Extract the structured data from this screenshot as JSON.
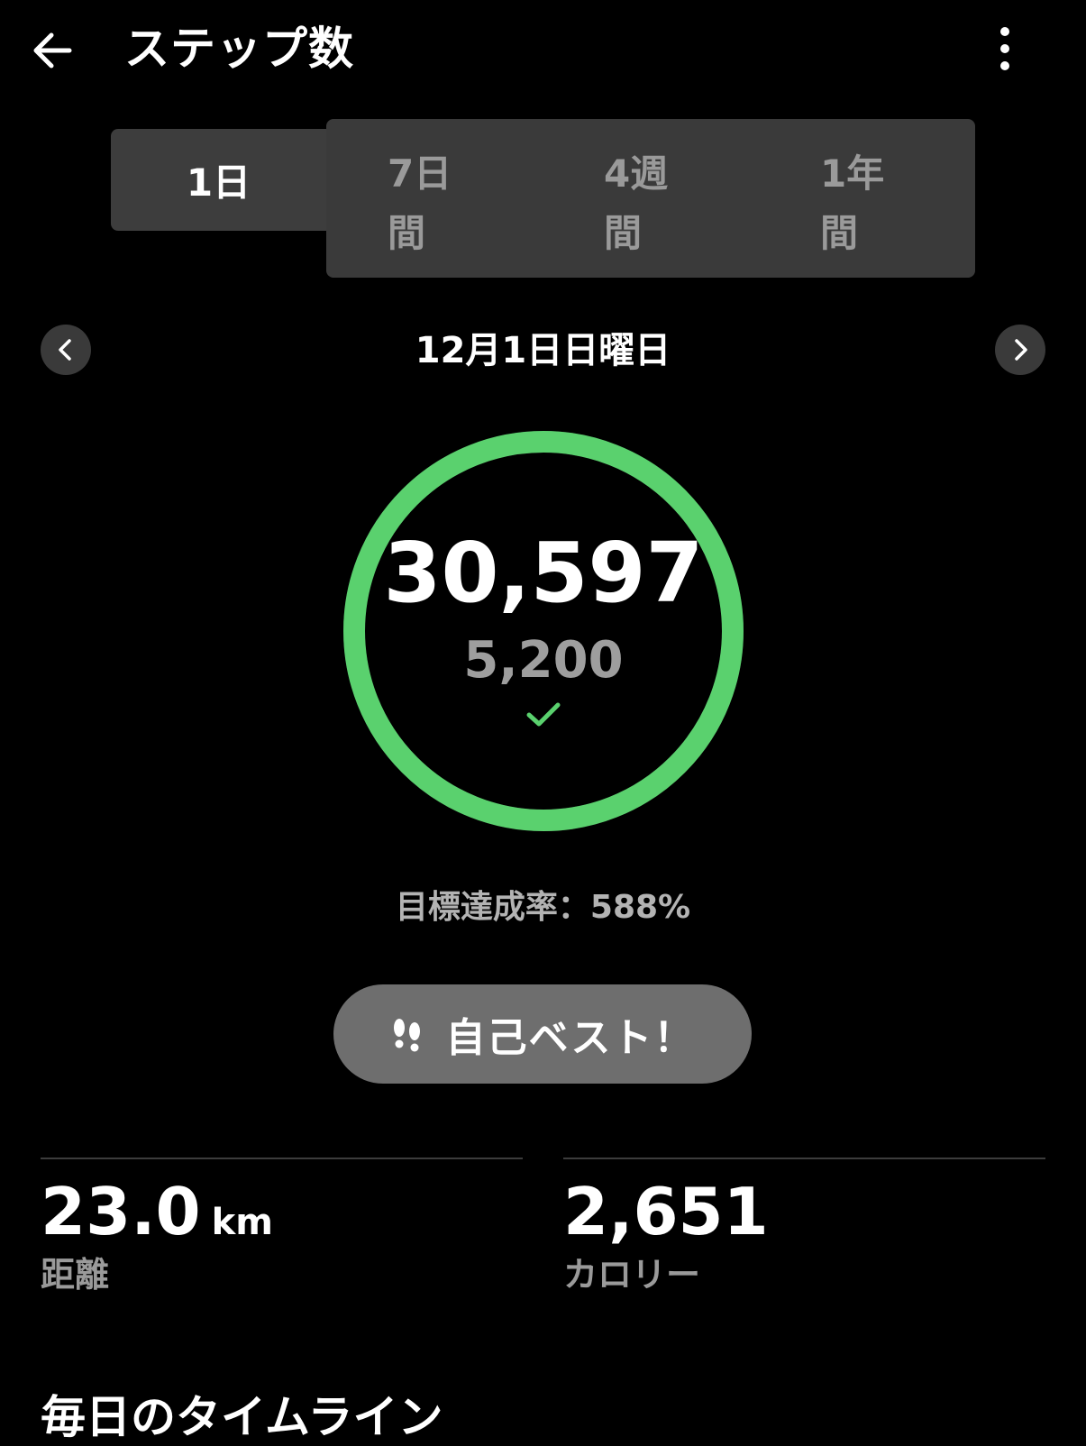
{
  "header": {
    "title": "ステップ数",
    "back_icon": "arrow-left-icon",
    "more_icon": "more-vertical-icon"
  },
  "tabs": [
    {
      "label": "1日",
      "selected": true
    },
    {
      "line1": "7日",
      "line2": "間",
      "selected": false
    },
    {
      "line1": "4週",
      "line2": "間",
      "selected": false
    },
    {
      "line1": "1年",
      "line2": "間",
      "selected": false
    }
  ],
  "date_nav": {
    "date": "12月1日日曜日",
    "prev_icon": "chevron-left-icon",
    "next_icon": "chevron-right-icon"
  },
  "summary": {
    "steps": "30,597",
    "goal": "5,200",
    "goal_progress": 1.0,
    "ring_color": "#5ad16e",
    "check_icon": "check-icon",
    "achievement_rate": "目標達成率：588%"
  },
  "best_badge": {
    "label": "自己ベスト！",
    "icon": "footprints-icon"
  },
  "stats": {
    "distance": {
      "value": "23.0",
      "unit": "km",
      "label": "距離"
    },
    "calories": {
      "value": "2,651",
      "label": "カロリー"
    }
  },
  "timeline": {
    "title": "毎日のタイムライン"
  }
}
